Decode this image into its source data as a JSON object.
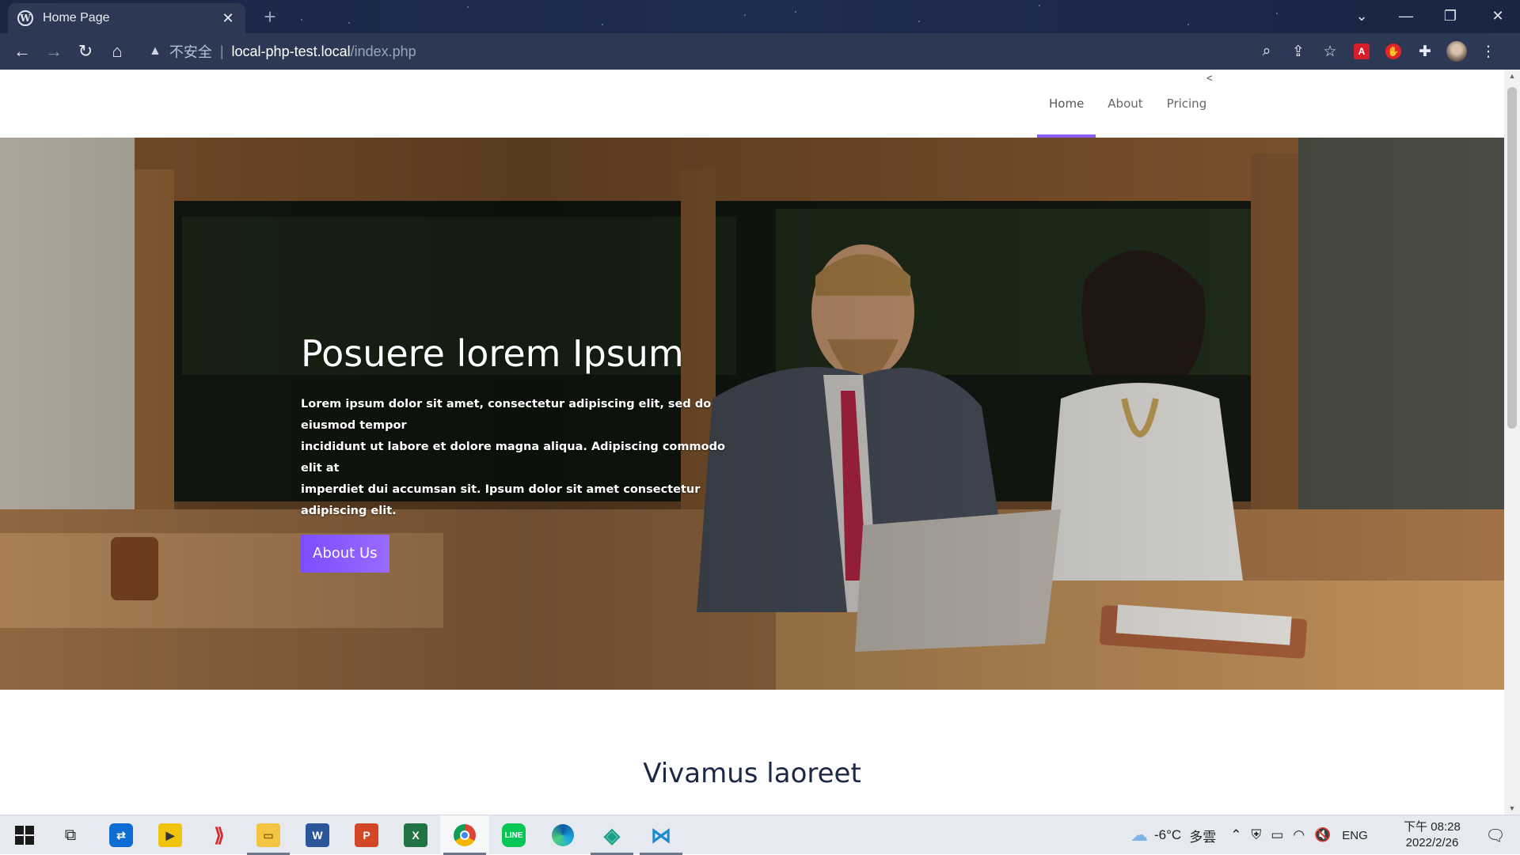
{
  "browser": {
    "tab_title": "Home Page",
    "new_tab": "+",
    "security_label": "不安全",
    "url_separator": "|",
    "url_host": "local-php-test.local",
    "url_path": "/index.php",
    "window_controls": {
      "dropdown": "⌄",
      "minimize": "—",
      "restore": "❐",
      "close": "✕"
    }
  },
  "site": {
    "nav": [
      {
        "label": "Home",
        "active": true
      },
      {
        "label": "About",
        "active": false
      },
      {
        "label": "Pricing",
        "active": false
      }
    ],
    "nav_toggle": "<",
    "accent_color": "#8a5cf6",
    "hero": {
      "title": "Posuere lorem Ipsum",
      "text_line1": "Lorem ipsum dolor sit amet, consectetur adipiscing elit, sed do eiusmod tempor",
      "text_line2": "incididunt ut labore et dolore magna aliqua. Adipiscing commodo elit at",
      "text_line3": "imperdiet dui accumsan sit. Ipsum dolor sit amet consectetur adipiscing elit.",
      "button": "About Us"
    },
    "section": {
      "title": "Vivamus laoreet"
    }
  },
  "taskbar": {
    "weather_temp": "-6°C",
    "weather_desc": "多雲",
    "language": "ENG",
    "time": "下午 08:28",
    "date": "2022/2/26",
    "apps": [
      "start-icon",
      "task-view-icon",
      "teamviewer-icon",
      "potplayer-icon",
      "app-icon",
      "file-explorer-icon",
      "word-icon",
      "powerpoint-icon",
      "excel-icon",
      "chrome-icon",
      "line-icon",
      "edge-icon",
      "app-green-icon",
      "vscode-icon"
    ]
  }
}
